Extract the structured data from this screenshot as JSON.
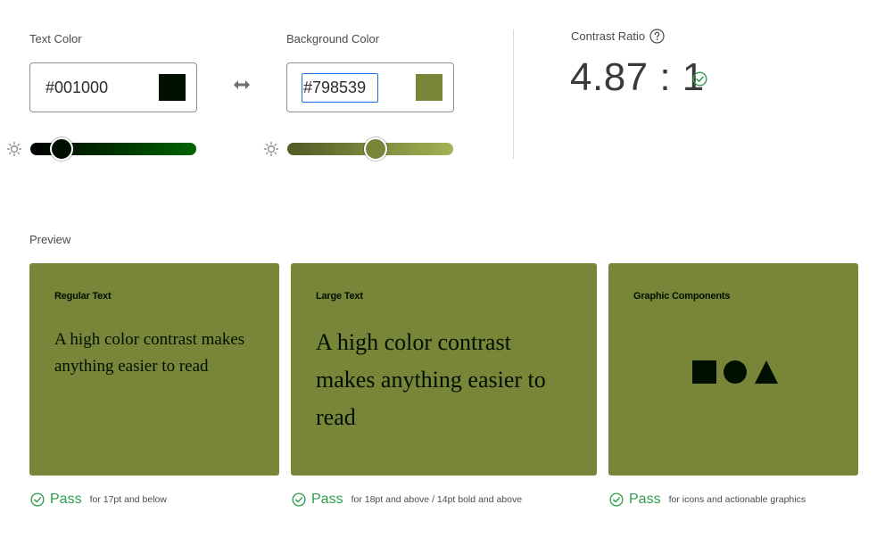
{
  "text_color": {
    "label": "Text Color",
    "value": "#001000",
    "swatch": "#001000",
    "slider_value": 0.19,
    "slider_gradient": [
      "#000000",
      "#006400"
    ],
    "brightness_icon": "sun-icon"
  },
  "background_color": {
    "label": "Background Color",
    "value": "#798539",
    "swatch": "#798539",
    "slider_value": 0.53,
    "slider_gradient": [
      "#4f5a25",
      "#a3b354"
    ],
    "brightness_icon": "sun-icon"
  },
  "swap_icon": "swap-arrows-icon",
  "contrast": {
    "label": "Contrast Ratio",
    "help_icon": "question-circle-icon",
    "value": "4.87 : 1",
    "status_icon": "check-circle-icon"
  },
  "preview": {
    "label": "Preview",
    "cards": [
      {
        "title": "Regular Text",
        "sample": "A high color contrast makes anything easier to read",
        "pass_label": "Pass",
        "pass_desc": "for 17pt and below"
      },
      {
        "title": "Large Text",
        "sample": "A high color contrast makes anything easier to read",
        "pass_label": "Pass",
        "pass_desc": "for 18pt and above / 14pt bold and above"
      },
      {
        "title": "Graphic Components",
        "shapes": [
          "square",
          "circle",
          "triangle"
        ],
        "pass_label": "Pass",
        "pass_desc": "for icons and actionable graphics"
      }
    ]
  },
  "colors": {
    "pass_green": "#2d9d4a",
    "accent_blue": "#1473e6"
  }
}
